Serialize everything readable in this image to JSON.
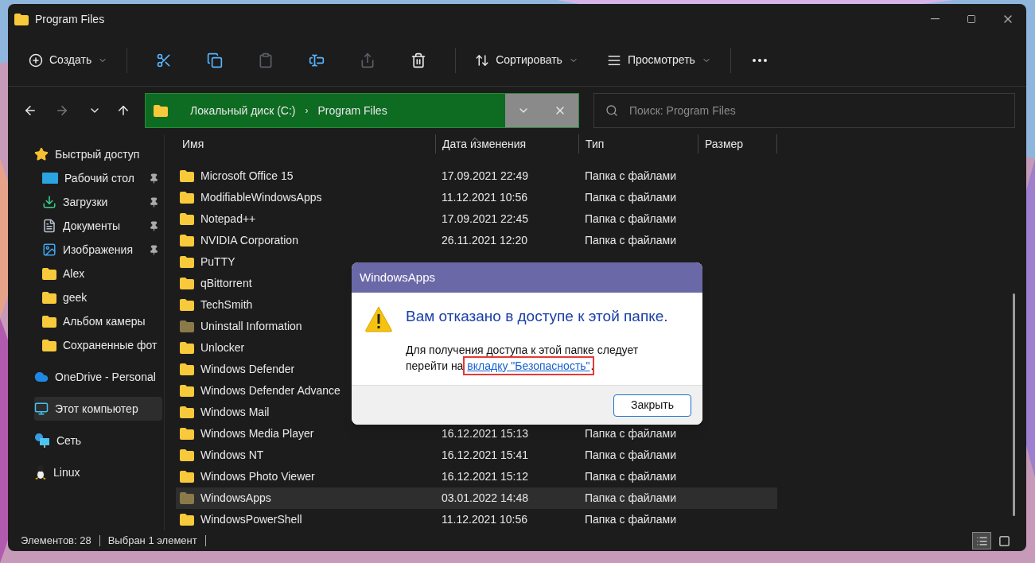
{
  "window": {
    "title": "Program Files"
  },
  "toolbar": {
    "new_label": "Создать",
    "sort_label": "Сортировать",
    "view_label": "Просмотреть",
    "icons": [
      {
        "kind": "cut",
        "disabled": false
      },
      {
        "kind": "copy",
        "disabled": false
      },
      {
        "kind": "paste",
        "disabled": true
      },
      {
        "kind": "rename",
        "disabled": false
      },
      {
        "kind": "share",
        "disabled": true
      },
      {
        "kind": "delete",
        "disabled": false
      }
    ]
  },
  "nav": {
    "back_disabled": false,
    "forward_disabled": true
  },
  "address": {
    "crumbs": [
      "Локальный диск (C:)",
      "Program Files"
    ],
    "separator": "›"
  },
  "search": {
    "placeholder": "Поиск: Program Files"
  },
  "sidebar": {
    "items": [
      {
        "kind": "star",
        "label": "Быстрый доступ",
        "pinned": false,
        "selected": false,
        "children": [
          {
            "kind": "desktop",
            "label": "Рабочий стол",
            "pinned": true,
            "selected": false
          },
          {
            "kind": "download",
            "label": "Загрузки",
            "pinned": true,
            "selected": false
          },
          {
            "kind": "documents",
            "label": "Документы",
            "pinned": true,
            "selected": false
          },
          {
            "kind": "pictures",
            "label": "Изображения",
            "pinned": true,
            "selected": false
          },
          {
            "kind": "folder",
            "label": "Alex",
            "pinned": false,
            "selected": false
          },
          {
            "kind": "folder",
            "label": "geek",
            "pinned": false,
            "selected": false
          },
          {
            "kind": "folder",
            "label": "Альбом камеры",
            "pinned": false,
            "selected": false
          },
          {
            "kind": "folder",
            "label": "Сохраненные фот",
            "pinned": false,
            "selected": false
          }
        ]
      },
      {
        "kind": "cloud",
        "label": "OneDrive - Personal",
        "pinned": false,
        "selected": false
      },
      {
        "kind": "pc",
        "label": "Этот компьютер",
        "pinned": false,
        "selected": true
      },
      {
        "kind": "network",
        "label": "Сеть",
        "pinned": false,
        "selected": false
      },
      {
        "kind": "linux",
        "label": "Linux",
        "pinned": false,
        "selected": false
      }
    ]
  },
  "table": {
    "columns": [
      "Имя",
      "Дата изменения",
      "Тип",
      "Размер"
    ],
    "rows": [
      {
        "name": "Microsoft Office 15",
        "date": "17.09.2021 22:49",
        "type": "Папка с файлами",
        "dimmed": false,
        "selected": false
      },
      {
        "name": "ModifiableWindowsApps",
        "date": "11.12.2021 10:56",
        "type": "Папка с файлами",
        "dimmed": false,
        "selected": false
      },
      {
        "name": "Notepad++",
        "date": "17.09.2021 22:45",
        "type": "Папка с файлами",
        "dimmed": false,
        "selected": false
      },
      {
        "name": "NVIDIA Corporation",
        "date": "26.11.2021 12:20",
        "type": "Папка с файлами",
        "dimmed": false,
        "selected": false
      },
      {
        "name": "PuTTY",
        "dimmed": false,
        "selected": false
      },
      {
        "name": "qBittorrent",
        "dimmed": false,
        "selected": false
      },
      {
        "name": "TechSmith",
        "dimmed": false,
        "selected": false
      },
      {
        "name": "Uninstall Information",
        "dimmed": true,
        "selected": false
      },
      {
        "name": "Unlocker",
        "dimmed": false,
        "selected": false
      },
      {
        "name": "Windows Defender",
        "dimmed": false,
        "selected": false
      },
      {
        "name": "Windows Defender Advance",
        "dimmed": false,
        "selected": false
      },
      {
        "name": "Windows Mail",
        "dimmed": false,
        "selected": false
      },
      {
        "name": "Windows Media Player",
        "date": "16.12.2021 15:13",
        "type": "Папка с файлами",
        "dimmed": false,
        "selected": false
      },
      {
        "name": "Windows NT",
        "date": "16.12.2021 15:41",
        "type": "Папка с файлами",
        "dimmed": false,
        "selected": false
      },
      {
        "name": "Windows Photo Viewer",
        "date": "16.12.2021 15:12",
        "type": "Папка с файлами",
        "dimmed": false,
        "selected": false
      },
      {
        "name": "WindowsApps",
        "date": "03.01.2022 14:48",
        "type": "Папка с файлами",
        "dimmed": true,
        "selected": true
      },
      {
        "name": "WindowsPowerShell",
        "date": "11.12.2021 10:56",
        "type": "Папка с файлами",
        "dimmed": false,
        "selected": false
      }
    ]
  },
  "status_bar": {
    "count": "Элементов: 28",
    "selection": "Выбран 1 элемент",
    "views": [
      {
        "kind": "details",
        "selected": true
      },
      {
        "kind": "tiles",
        "selected": false
      }
    ]
  },
  "dialog": {
    "title": "WindowsApps",
    "heading": "Вам отказано в доступе к этой папке.",
    "message": "Для получения доступа к этой папке следует перейти на",
    "link": "вкладку \"Безопасность\"",
    "link_highlighted": true,
    "trailing": ".",
    "button": "Закрыть"
  }
}
